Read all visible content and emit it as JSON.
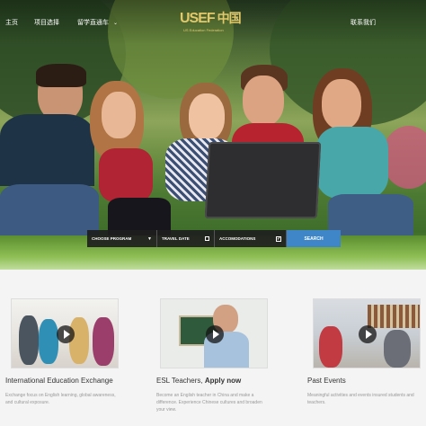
{
  "nav": {
    "home": "主页",
    "projects": "项目选择",
    "study_abroad": "留学直通车",
    "contact": "联系我们"
  },
  "logo": {
    "mark_latin": "USEF",
    "mark_cjk": "中国",
    "subtitle": "US Education Federation"
  },
  "search": {
    "program_label": "CHOOSE PROGRAM",
    "date_label": "TRAVEL DATE",
    "accom_label": "ACCOMODATIONS",
    "button_label": "SEARCH"
  },
  "cards": [
    {
      "title": "International Education Exchange",
      "title_bold": "",
      "description": "Exchange focus on English learning, global awareness, and cultural exposure."
    },
    {
      "title": "ESL Teachers, ",
      "title_bold": "Apply now",
      "description": "Become an English teacher in China and make a difference. Experience Chinese cultures and broaden your view."
    },
    {
      "title": "Past Events",
      "title_bold": "",
      "description": "Meaningful activities and events insured students and teachers."
    }
  ],
  "colors": {
    "accent": "#3f86c8",
    "logo_gold": "#e2c86a"
  }
}
